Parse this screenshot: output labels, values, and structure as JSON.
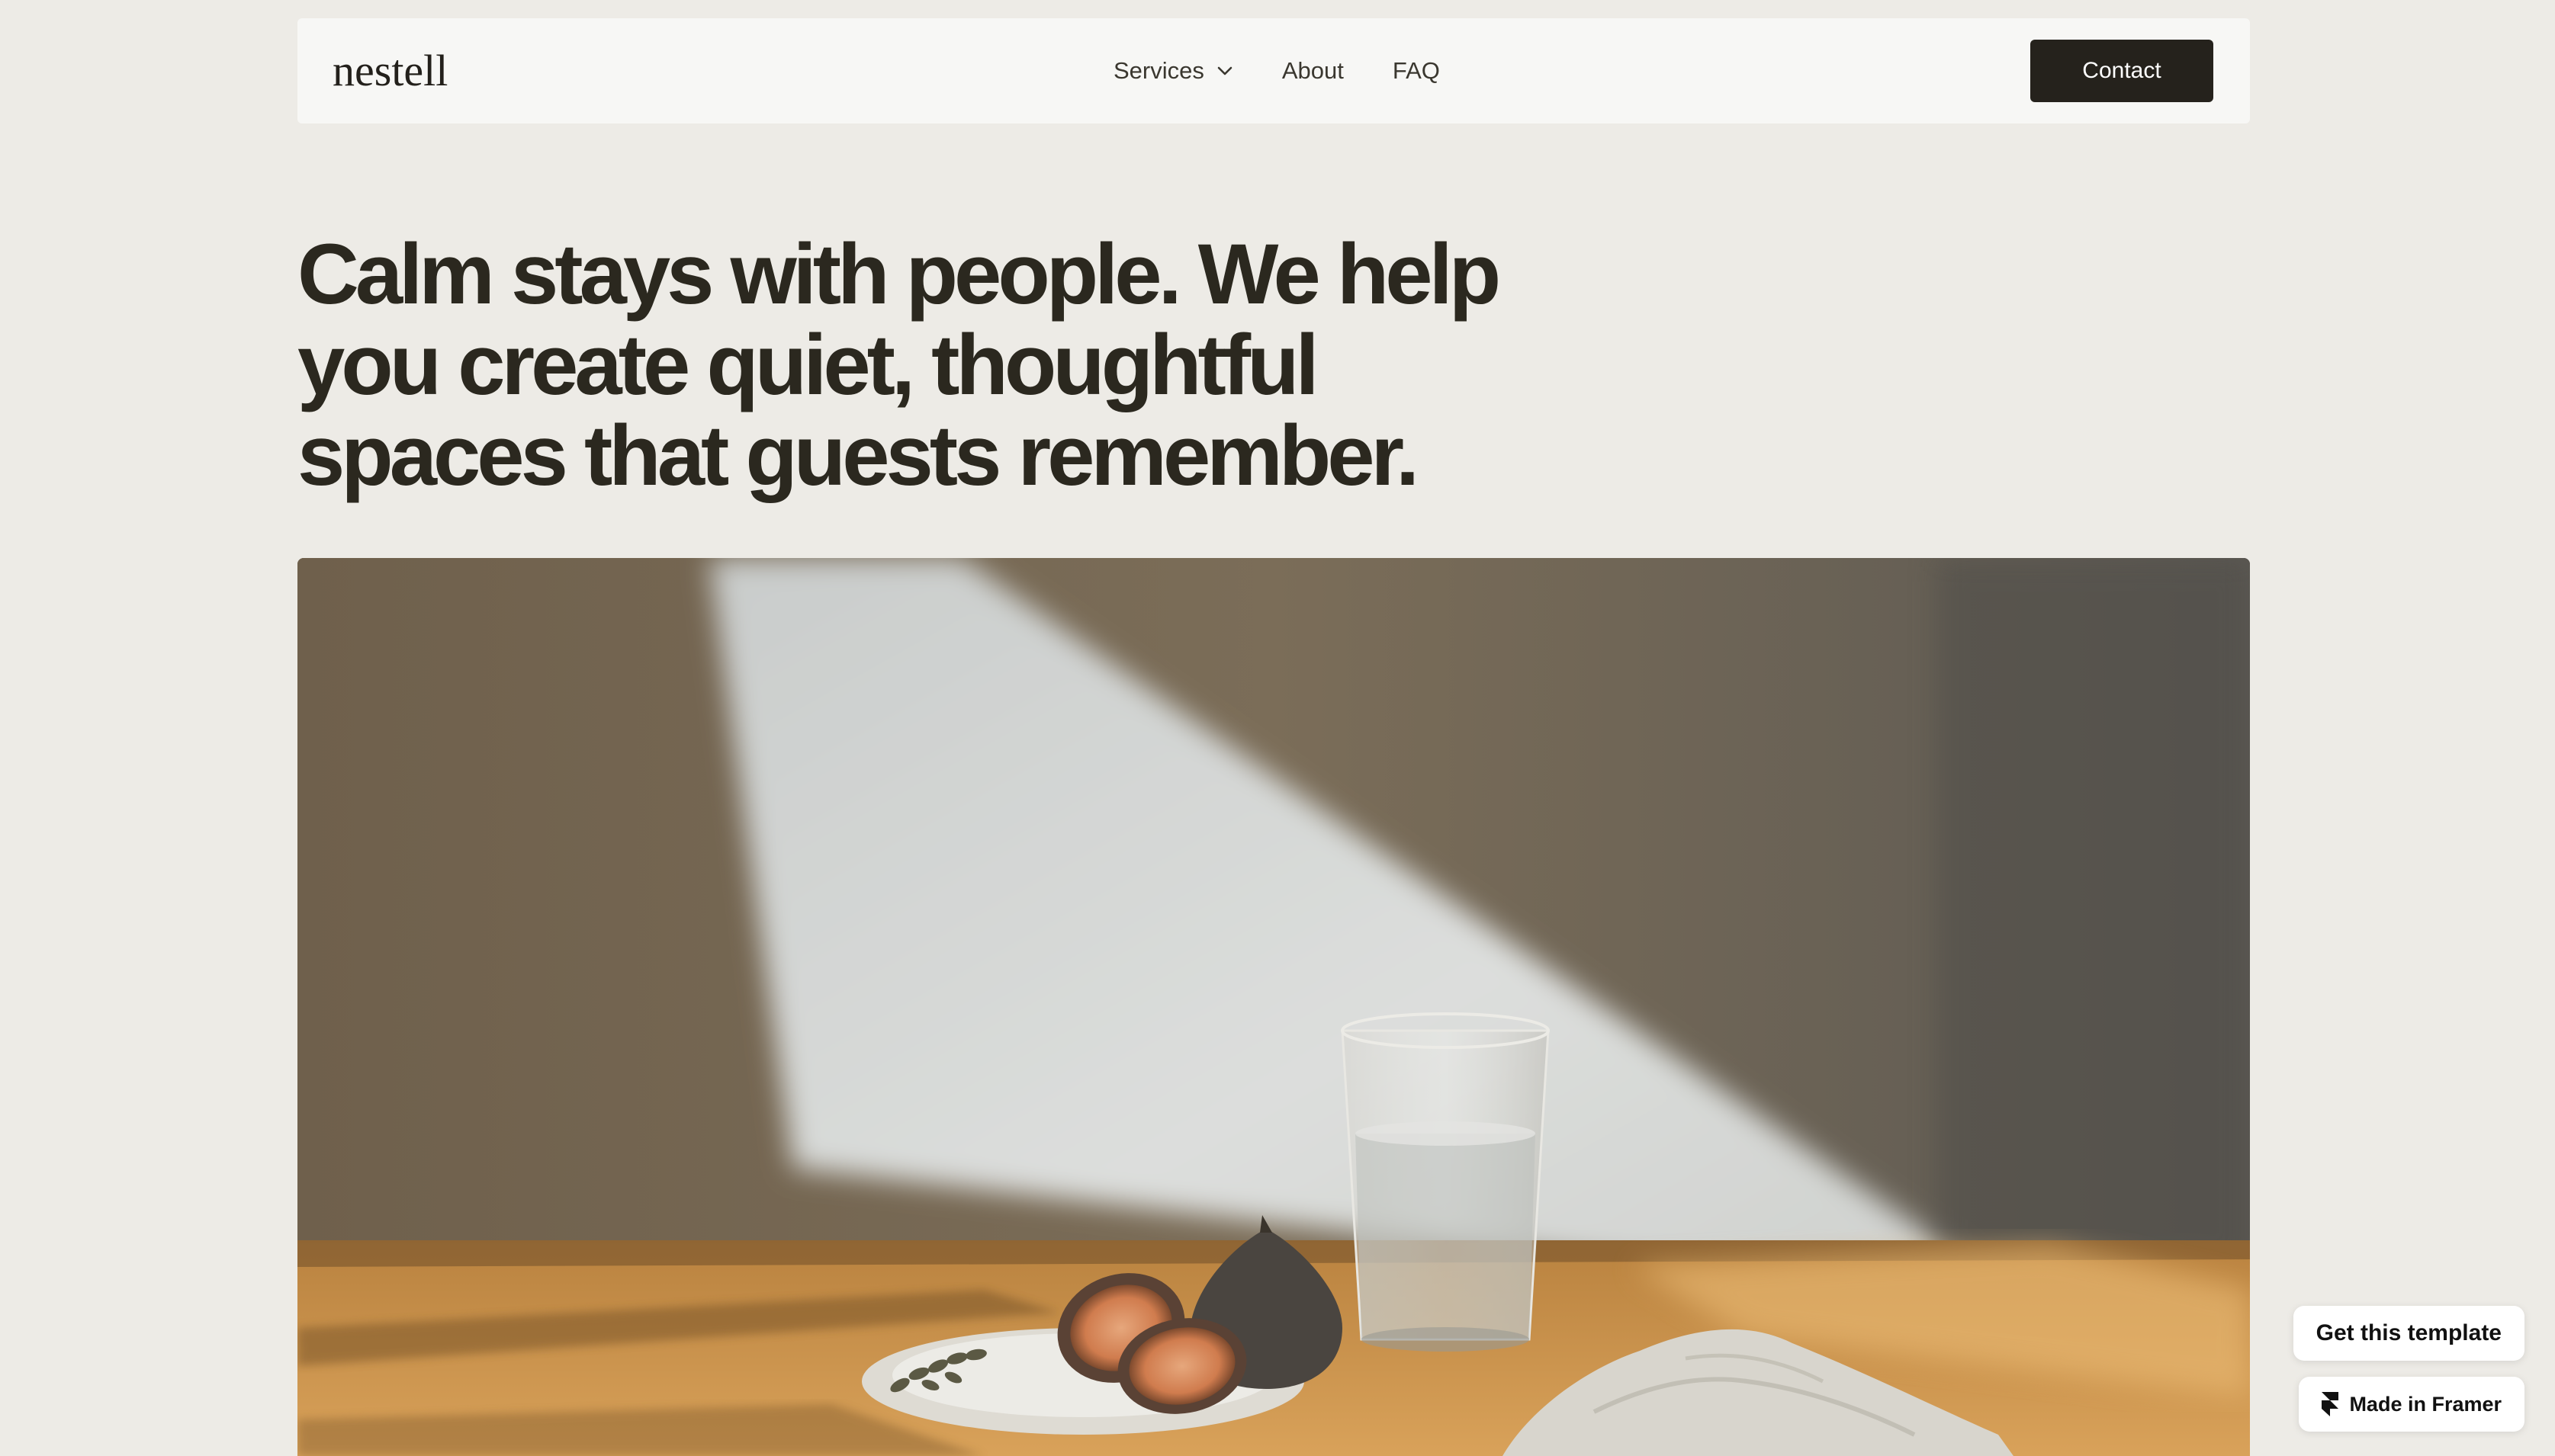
{
  "header": {
    "logo": "nestell",
    "nav": [
      {
        "label": "Services",
        "has_dropdown": true,
        "icon": "chevron-down-icon"
      },
      {
        "label": "About"
      },
      {
        "label": "FAQ"
      }
    ],
    "contact_label": "Contact"
  },
  "hero": {
    "headline": "Calm stays with people. We help you create quiet, thoughtful spaces that guests remember.",
    "image_alt": "Sunlit table with a glass of water, a plate of figs and a linen napkin"
  },
  "badges": {
    "template_label": "Get this template",
    "framer_label": "Made in Framer",
    "framer_icon": "framer-logo-icon"
  },
  "colors": {
    "background": "#edebe6",
    "nav_background": "#f7f7f5",
    "text_dark": "#2b281f",
    "button_background": "#25221c",
    "button_text": "#ffffff"
  }
}
